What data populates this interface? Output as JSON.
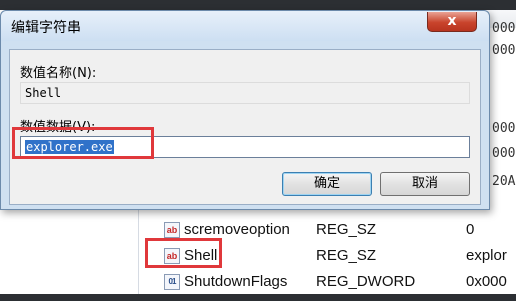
{
  "dialog": {
    "title": "编辑字符串",
    "close_label": "x",
    "value_name_label": "数值名称(N):",
    "value_name": "Shell",
    "value_data_label": "数值数据(V):",
    "value_data": "explorer.exe",
    "ok_label": "确定",
    "cancel_label": "取消"
  },
  "registry": {
    "rows": [
      {
        "icon": "ab",
        "name": "scremoveoption",
        "type": "REG_SZ",
        "data": "0"
      },
      {
        "icon": "ab",
        "name": "Shell",
        "type": "REG_SZ",
        "data": "explor"
      },
      {
        "icon": "bin",
        "name": "ShutdownFlags",
        "type": "REG_DWORD",
        "data": "0x000"
      }
    ],
    "partial_values": [
      "000",
      "000",
      "000",
      "000",
      "20A"
    ]
  },
  "colors": {
    "highlight": "#e0383b",
    "selection": "#3072c9"
  }
}
